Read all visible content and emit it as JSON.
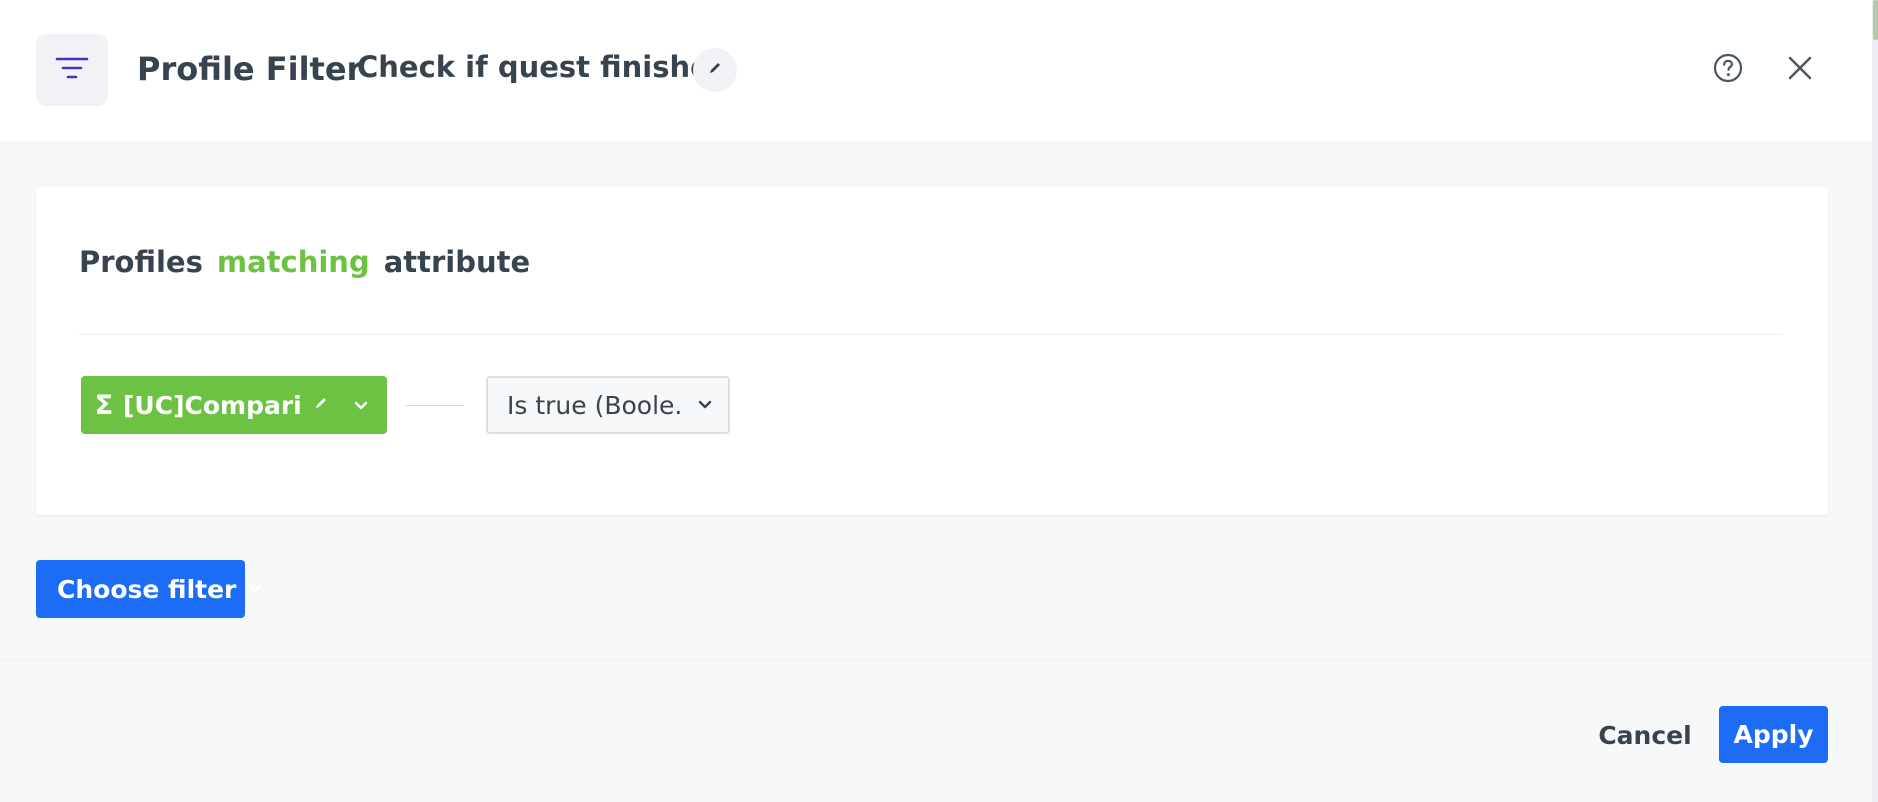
{
  "header": {
    "title": "Profile Filter",
    "filter_name": "Check if quest finished",
    "icons": {
      "badge": "filter-lines-icon",
      "edit_name": "pencil-icon",
      "help": "question-circle-icon",
      "close": "close-icon"
    }
  },
  "condition": {
    "sentence": {
      "word1": "Profiles",
      "accent_word": "matching",
      "word3": "attribute"
    },
    "attribute": {
      "icon": "sigma-icon",
      "symbol": "Σ",
      "label": "[UC]Compari...",
      "edit_icon": "pencil-icon",
      "caret_icon": "chevron-down-icon"
    },
    "operator": {
      "label": "Is true (Boole...",
      "caret_icon": "chevron-down-icon"
    }
  },
  "actions": {
    "choose_filter_label": "Choose filter",
    "cancel_label": "Cancel",
    "apply_label": "Apply"
  },
  "colors": {
    "accent_green": "#6cc243",
    "primary_blue": "#1c6cf5",
    "brand_purple": "#4b33b8",
    "text": "#384350",
    "background": "#f7f8fa"
  }
}
